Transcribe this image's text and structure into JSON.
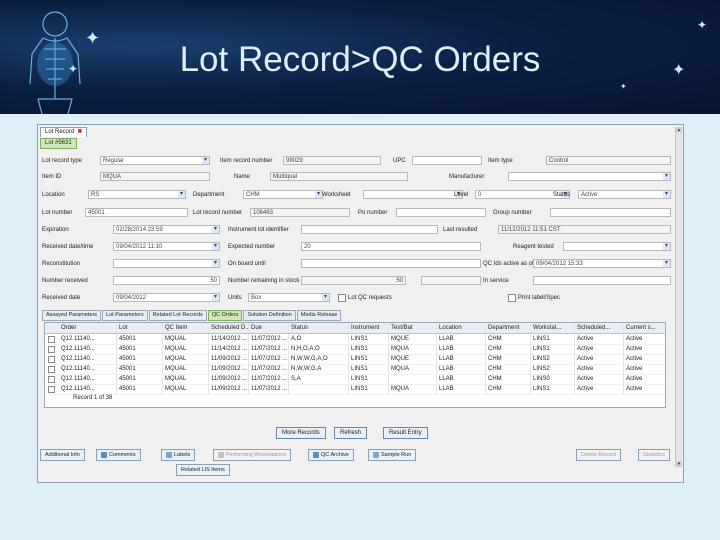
{
  "slide": {
    "title": "Lot Record>QC Orders"
  },
  "app": {
    "doc_tabs": [
      "Lot Record",
      ""
    ],
    "sub_tab": "Lot #5631",
    "form": {
      "lot_record_type": {
        "label": "Lot record type",
        "value": "Regular"
      },
      "item_record_number": {
        "label": "Item record number",
        "value": "99029"
      },
      "upc": {
        "label": "UPC",
        "value": ""
      },
      "item_type": {
        "label": "Item type",
        "value": "Control"
      },
      "item_id": {
        "label": "Item ID",
        "value": "MQUA"
      },
      "name": {
        "label": "Name",
        "value": "Multiqual"
      },
      "manufacturer": {
        "label": "Manufacturer",
        "value": ""
      },
      "location": {
        "label": "Location",
        "value": "RS"
      },
      "department": {
        "label": "Department",
        "value": "CHM"
      },
      "worksheet": {
        "label": "Worksheet",
        "value": ""
      },
      "level": {
        "label": "Level",
        "value": "0"
      },
      "status": {
        "label": "Status",
        "value": "Active"
      },
      "lot_number": {
        "label": "Lot number",
        "value": "45001"
      },
      "lot_record_number": {
        "label": "Lot record number",
        "value": "106463"
      },
      "po_number": {
        "label": "Po number",
        "value": ""
      },
      "group_number": {
        "label": "Group number",
        "value": ""
      },
      "expiration": {
        "label": "Expiration",
        "value": "02/28/2014 23:59"
      },
      "instrument_lot_identifier": {
        "label": "Instrument lot identifier",
        "value": ""
      },
      "last_resulted": {
        "label": "Last resulted",
        "value": "11/12/2012 11:51 CST"
      },
      "received_date": {
        "label": "Received date/time",
        "value": "09/04/2012 11:10"
      },
      "expected_number": {
        "label": "Expected number",
        "value": "20"
      },
      "reagent_tested": {
        "label": "Reagent tested",
        "value": ""
      },
      "reconstitution": {
        "label": "Reconstitution",
        "value": ""
      },
      "on_board_until": {
        "label": "On board until",
        "value": ""
      },
      "qc_ids_active_as_of": {
        "label": "QC Ids active as of",
        "value": "09/04/2012 15:33"
      },
      "number_received": {
        "label": "Number received",
        "value": "50"
      },
      "number_remaining": {
        "label": "Number remaining in stock",
        "value": "50"
      },
      "in_service": {
        "label": "In service",
        "value": ""
      },
      "received_date_2": {
        "label": "Received date",
        "value": "09/04/2012"
      },
      "units": {
        "label": "Units",
        "value": "Box"
      },
      "ltd_qc_requests": {
        "label": "Lot QC requests"
      },
      "print_label": {
        "label": "Print label/Spec"
      }
    },
    "panel_tabs": [
      "Assayed Parameters",
      "Lot Parameters",
      "Related Lot Records",
      "QC Orders",
      "Solution Definition",
      "Media Release"
    ],
    "active_panel_tab": "QC Orders",
    "grid": {
      "columns": [
        "Order",
        "Lot",
        "QC Item",
        "Scheduled D...",
        "Due",
        "Status",
        "Instrument",
        "Test/Bat",
        "Location",
        "Department",
        "Workstat...",
        "Scheduled...",
        "Current s..."
      ],
      "rows": [
        [
          "Q12.11140...",
          "45001",
          "MQUAL",
          "11/14/2012 ...",
          "11/07/2012 ...",
          "A,O",
          "LINS1",
          "MQUE",
          "LLAB",
          "CHM",
          "LINS1",
          "Active",
          "Active"
        ],
        [
          "Q12.11140...",
          "45001",
          "MQUAL",
          "11/14/2012 ...",
          "11/07/2012 ...",
          "N,H,O,A,O",
          "LINS1",
          "MQUA",
          "LLAB",
          "CHM",
          "LINS1",
          "Active",
          "Active"
        ],
        [
          "Q12.11140...",
          "45001",
          "MQUAL",
          "11/09/2012 ...",
          "11/07/2012 ...",
          "N,W,W,G,A,O",
          "LINS1",
          "MQUE",
          "LLAB",
          "CHM",
          "LINS2",
          "Active",
          "Active"
        ],
        [
          "Q12.11140...",
          "45001",
          "MQUAL",
          "11/09/2012 ...",
          "11/07/2012 ...",
          "N,W,W,G,A",
          "LINS1",
          "MQUA",
          "LLAB",
          "CHM",
          "LINS2",
          "Active",
          "Active"
        ],
        [
          "Q12.11140...",
          "45001",
          "MQUAL",
          "11/09/2012 ...",
          "11/07/2012 ...",
          "S,A",
          "LINS1",
          "",
          "LLAB",
          "CHM",
          "LINS0",
          "Active",
          "Active"
        ],
        [
          "Q12.11140...",
          "45001",
          "MQUAL",
          "11/09/2012 ...",
          "11/07/2012 ...",
          "",
          "LINS1",
          "MQUA",
          "LLAB",
          "CHM",
          "LINS1",
          "Active",
          "Active"
        ]
      ],
      "footer": "Record 1 of 38"
    },
    "grid_buttons": [
      "More Records",
      "Refresh",
      "Result Entry"
    ],
    "action_buttons": [
      "Additional Info",
      "Comments",
      "Labels",
      "Performing Workstations",
      "QC Archive",
      "Sample Run",
      "Related LIS Items"
    ],
    "right_buttons": [
      "Delete Record",
      "Statistics"
    ],
    "colors": {
      "active_tab": "#cfe7b8",
      "banner": "#0c1f43",
      "frame": "#8aa0b8"
    }
  }
}
